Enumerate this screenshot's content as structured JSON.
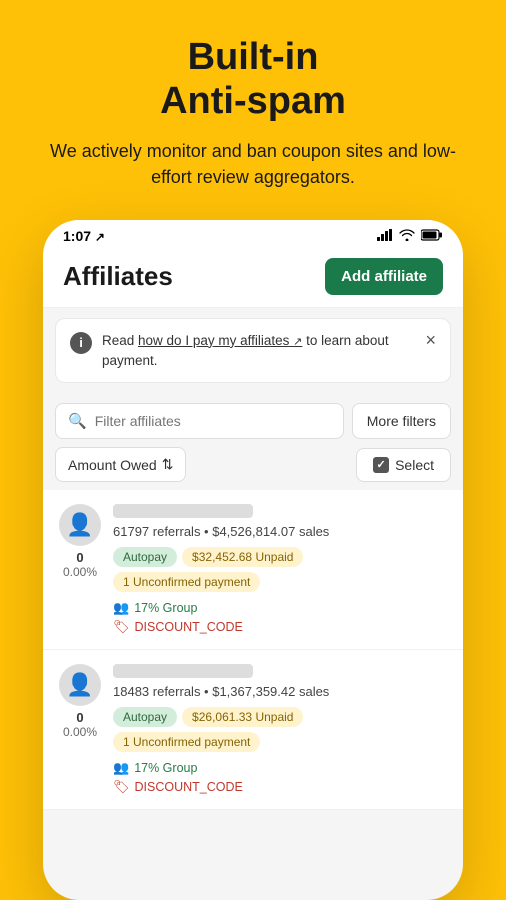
{
  "hero": {
    "title_line1": "Built-in",
    "title_line2": "Anti-spam",
    "subtitle": "We actively monitor and ban coupon sites and low-effort review aggregators."
  },
  "status_bar": {
    "time": "1:07",
    "time_icon": "↗"
  },
  "app": {
    "title": "Affiliates",
    "add_button": "Add affiliate"
  },
  "info_banner": {
    "info_label": "i",
    "text_before_link": "Read ",
    "link_text": "how do I pay my affiliates",
    "text_after_link": " to learn about payment.",
    "close": "×"
  },
  "search": {
    "placeholder": "Filter affiliates",
    "more_filters": "More filters"
  },
  "sort": {
    "amount_owed": "Amount Owed",
    "sort_icon": "⇅",
    "select_label": "Select"
  },
  "affiliates": [
    {
      "ref_count": "0",
      "ref_percent": "0.00%",
      "stats": "61797 referrals • $4,526,814.07 sales",
      "tags": [
        "Autopay",
        "$32,452.68 Unpaid",
        "1 Unconfirmed payment"
      ],
      "group": "17% Group",
      "discount": "DISCOUNT_CODE"
    },
    {
      "ref_count": "0",
      "ref_percent": "0.00%",
      "stats": "18483 referrals • $1,367,359.42 sales",
      "tags": [
        "Autopay",
        "$26,061.33 Unpaid",
        "1 Unconfirmed payment"
      ],
      "group": "17% Group",
      "discount": "DISCOUNT_CODE"
    }
  ]
}
